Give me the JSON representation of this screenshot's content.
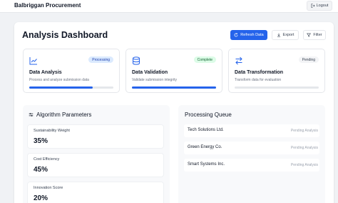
{
  "header": {
    "brand": "Balbriggan Procurement",
    "logout_label": "Logout"
  },
  "page": {
    "title": "Analysis Dashboard"
  },
  "toolbar": {
    "refresh_label": "Refresh Data",
    "export_label": "Export",
    "filter_label": "Filter"
  },
  "cards": [
    {
      "title": "Data Analysis",
      "description": "Process and analyze submission data",
      "status": "Processing",
      "progress": 0.75,
      "icon": "chart-line-icon"
    },
    {
      "title": "Data Validation",
      "description": "Validate submission integrity",
      "status": "Complete",
      "progress": 1.0,
      "icon": "database-icon"
    },
    {
      "title": "Data Transformation",
      "description": "Transform data for evaluation",
      "status": "Pending",
      "progress": 0.0,
      "icon": "swap-arrows-icon"
    }
  ],
  "parameters": {
    "title": "Algorithm Parameters",
    "items": [
      {
        "label": "Sustainability Weight",
        "value": "35%"
      },
      {
        "label": "Cost Efficiency",
        "value": "45%"
      },
      {
        "label": "Innovation Score",
        "value": "20%"
      }
    ]
  },
  "queue": {
    "title": "Processing Queue",
    "items": [
      {
        "name": "Tech Solutions Ltd.",
        "status": "Pending Analysis"
      },
      {
        "name": "Green Energy Co.",
        "status": "Pending Analysis"
      },
      {
        "name": "Smart Systems Inc.",
        "status": "Pending Analysis"
      }
    ]
  },
  "colors": {
    "accent": "#2563eb",
    "processing_bg": "#dbeafe",
    "processing_fg": "#1e40af",
    "complete_bg": "#dcfce7",
    "complete_fg": "#166534",
    "pending_bg": "#f3f4f6",
    "pending_fg": "#374151"
  }
}
